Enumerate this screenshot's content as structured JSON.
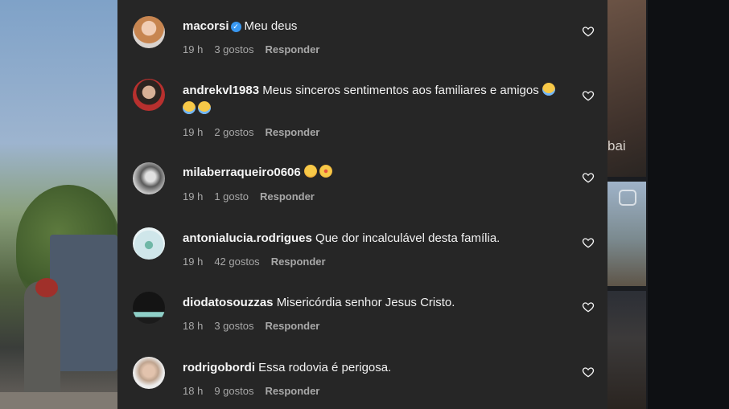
{
  "comments": [
    {
      "username": "macorsi",
      "verified": true,
      "text": "Meu deus",
      "time": "19 h",
      "likes": "3 gostos",
      "reply": "Responder",
      "emojis": []
    },
    {
      "username": "andrekvl1983",
      "verified": false,
      "text": "Meus sinceros sentimentos aos familiares e amigos",
      "time": "19 h",
      "likes": "2 gostos",
      "reply": "Responder",
      "emojis": [
        "crying-face-emoji",
        "crying-face-emoji",
        "crying-face-emoji"
      ]
    },
    {
      "username": "milaberraqueiro0606",
      "verified": false,
      "text": "",
      "time": "19 h",
      "likes": "1 gosto",
      "reply": "Responder",
      "emojis": [
        "sad-sweat-face-emoji",
        "astonished-face-emoji"
      ]
    },
    {
      "username": "antonialucia.rodrigues",
      "verified": false,
      "text": "Que dor incalculável desta família.",
      "time": "19 h",
      "likes": "42 gostos",
      "reply": "Responder",
      "emojis": []
    },
    {
      "username": "diodatosouzzas",
      "verified": false,
      "text": "Misericórdia senhor Jesus Cristo.",
      "time": "18 h",
      "likes": "3 gostos",
      "reply": "Responder",
      "emojis": []
    },
    {
      "username": "rodrigobordi",
      "verified": false,
      "text": "Essa rodovia é perigosa.",
      "time": "18 h",
      "likes": "9 gostos",
      "reply": "Responder",
      "emojis": []
    }
  ],
  "background_right": {
    "partial_text": "bai"
  },
  "icons": {
    "like": "heart-outline-icon",
    "verified": "verified-badge-icon",
    "play": "play-icon"
  },
  "colors": {
    "panel": "#262626",
    "text": "#f5f5f5",
    "meta": "#a8a8a8",
    "verified": "#3897f0"
  }
}
